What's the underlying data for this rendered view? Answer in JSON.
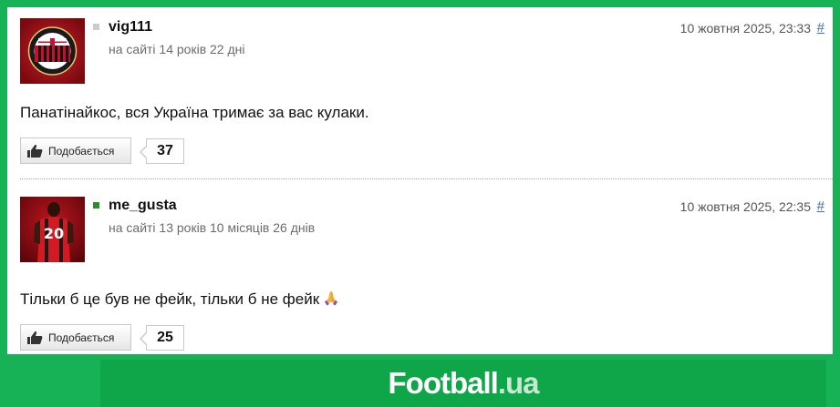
{
  "comments": [
    {
      "username": "vig111",
      "online": false,
      "status_color": "#cccccc",
      "on_site": "на сайті 14 років 22 дні",
      "date": "10 жовтня 2025, 23:33",
      "permalink": "#",
      "text": "Панатінайкос, вся Україна тримає за вас кулаки.",
      "like_label": "Подобається",
      "likes": "37",
      "avatar_icon": "ac-milan-crest-icon"
    },
    {
      "username": "me_gusta",
      "online": true,
      "status_color": "#2e8b2e",
      "on_site": "на сайті 13 років 10 місяців 26 днів",
      "date": "10 жовтня 2025, 22:35",
      "permalink": "#",
      "text": "Тільки б це був не фейк, тільки б не фейк",
      "emoji": "praying-hands-icon",
      "like_label": "Подобається",
      "likes": "25",
      "avatar_icon": "player-number-20-icon"
    }
  ],
  "footer": {
    "logo_main": "Football",
    "logo_tld": ".ua"
  },
  "colors": {
    "background_green": "#17b255",
    "footer_green": "#0fa64a",
    "link_blue": "#3a6fb0"
  }
}
